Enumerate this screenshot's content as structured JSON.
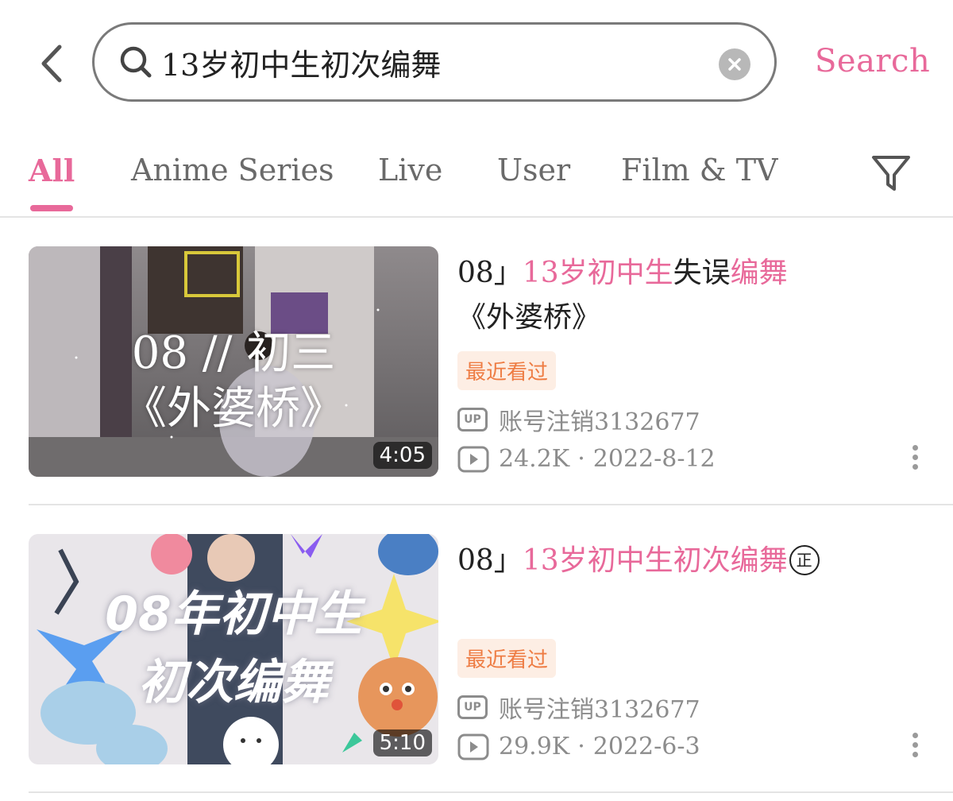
{
  "search": {
    "query": "13岁初中生初次编舞",
    "button_label": "Search"
  },
  "tabs": [
    {
      "label": "All",
      "active": true
    },
    {
      "label": "Anime Series",
      "active": false
    },
    {
      "label": "Live",
      "active": false
    },
    {
      "label": "User",
      "active": false
    },
    {
      "label": "Film & TV",
      "active": false
    }
  ],
  "icons": {
    "back": "chevron-left-icon",
    "search": "search-icon",
    "clear": "clear-icon",
    "filter": "filter-icon",
    "uploader": "up-icon",
    "views": "play-icon",
    "more": "more-vertical-icon"
  },
  "colors": {
    "accent": "#e8699a",
    "badge_text": "#ee7c43",
    "badge_bg": "#fdeee4",
    "meta_text": "#8c8c8c"
  },
  "results": [
    {
      "title_parts": [
        {
          "text": "08」",
          "highlight": false
        },
        {
          "text": "13岁初中生",
          "highlight": true
        },
        {
          "text": "失误",
          "highlight": false
        },
        {
          "text": "编舞",
          "highlight": true
        },
        {
          "text": "《外婆桥》",
          "highlight": false
        }
      ],
      "thumb_text_line1": "08 // 初三",
      "thumb_text_line2": "《外婆桥》",
      "duration": "4:05",
      "badge": "最近看过",
      "up_label": "UP",
      "uploader": "账号注销3132677",
      "views": "24.2K",
      "separator": "·",
      "date": "2022-8-12"
    },
    {
      "title_parts": [
        {
          "text": "08」",
          "highlight": false
        },
        {
          "text": "13岁初中生初次编舞",
          "highlight": true
        }
      ],
      "title_badge": "正",
      "thumb_text_line1": "08年初中生",
      "thumb_text_line2": "初次编舞",
      "duration": "5:10",
      "badge": "最近看过",
      "up_label": "UP",
      "uploader": "账号注销3132677",
      "views": "29.9K",
      "separator": "·",
      "date": "2022-6-3"
    }
  ]
}
